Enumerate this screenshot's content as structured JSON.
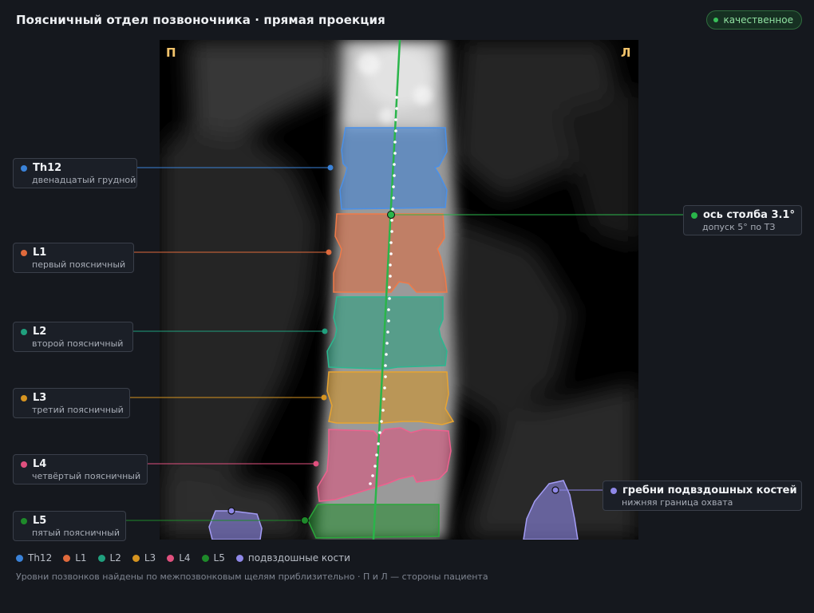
{
  "header": {
    "title": "Поясничный отдел позвоночника · прямая проекция",
    "quality_badge": "качественное"
  },
  "sides": {
    "right": "П",
    "left": "Л"
  },
  "colors": {
    "Th12": "#3a82d8",
    "L1": "#e06a3c",
    "L2": "#20a07e",
    "L3": "#d69420",
    "L4": "#e0507e",
    "L5": "#1e8a2a",
    "iliac": "#8f88e8",
    "axis": "#2ab54a"
  },
  "vertebrae": [
    {
      "id": "Th12",
      "name": "Th12",
      "description": "двенадцатый грудной"
    },
    {
      "id": "L1",
      "name": "L1",
      "description": "первый поясничный"
    },
    {
      "id": "L2",
      "name": "L2",
      "description": "второй поясничный"
    },
    {
      "id": "L3",
      "name": "L3",
      "description": "третий поясничный"
    },
    {
      "id": "L4",
      "name": "L4",
      "description": "четвёртый поясничный"
    },
    {
      "id": "L5",
      "name": "L5",
      "description": "пятый поясничный"
    }
  ],
  "axis_callout": {
    "label": "ось столба 3.1°",
    "description": "допуск 5° по ТЗ",
    "angle_deg": 3.1
  },
  "iliac_callout": {
    "label": "гребни подвздошных костей",
    "description": "нижняя граница охвата"
  },
  "legend": [
    {
      "id": "Th12",
      "label": "Th12"
    },
    {
      "id": "L1",
      "label": "L1"
    },
    {
      "id": "L2",
      "label": "L2"
    },
    {
      "id": "L3",
      "label": "L3"
    },
    {
      "id": "L4",
      "label": "L4"
    },
    {
      "id": "L5",
      "label": "L5"
    },
    {
      "id": "iliac",
      "label": "подвздошные кости"
    }
  ],
  "footnote": "Уровни позвонков найдены по межпозвонковым щелям приблизительно · П и Л — стороны пациента"
}
